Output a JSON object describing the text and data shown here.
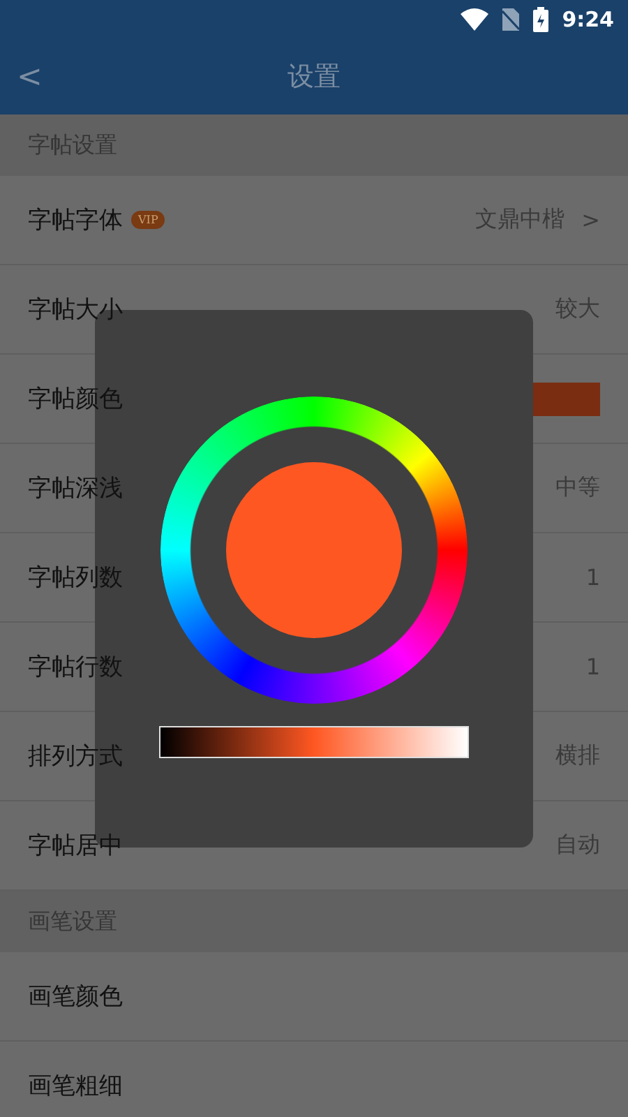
{
  "status_bar": {
    "time": "9:24"
  },
  "header": {
    "back": "<",
    "title": "设置"
  },
  "sections": [
    {
      "title": "字帖设置",
      "rows": [
        {
          "kind": "arrow",
          "label": "字帖字体",
          "badge": "VIP",
          "value": "文鼎中楷",
          "chevron": ">"
        },
        {
          "kind": "value",
          "label": "字帖大小",
          "value": "较大"
        },
        {
          "kind": "swatch",
          "label": "字帖颜色",
          "color": "#7b2d12"
        },
        {
          "kind": "value",
          "label": "字帖深浅",
          "value": "中等"
        },
        {
          "kind": "value",
          "label": "字帖列数",
          "value": "1"
        },
        {
          "kind": "value",
          "label": "字帖行数",
          "value": "1"
        },
        {
          "kind": "value",
          "label": "排列方式",
          "value": "横排"
        },
        {
          "kind": "value",
          "label": "字帖居中",
          "value": "自动"
        }
      ]
    },
    {
      "title": "画笔设置",
      "rows": [
        {
          "kind": "empty",
          "label": "画笔颜色"
        },
        {
          "kind": "empty",
          "label": "画笔粗细"
        }
      ]
    }
  ],
  "color_picker": {
    "color": "#ff5722"
  }
}
